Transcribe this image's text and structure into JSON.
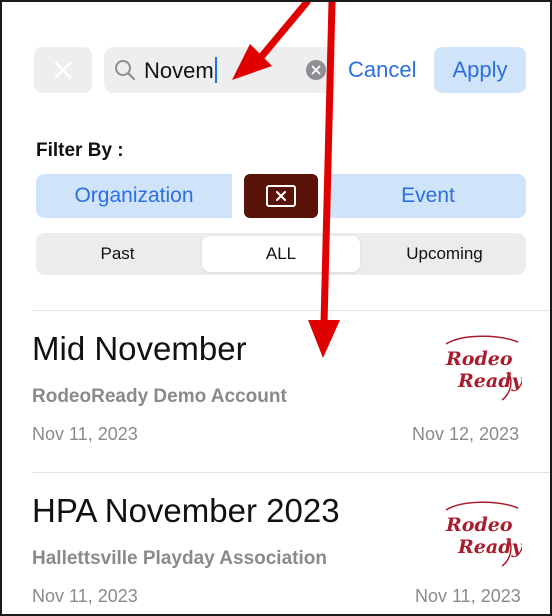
{
  "search": {
    "clear_icon": "close-icon",
    "search_icon": "search-icon",
    "query": "Novem",
    "clear_field_icon": "clear-circle-icon"
  },
  "actions": {
    "cancel_label": "Cancel",
    "apply_label": "Apply"
  },
  "filter": {
    "label": "Filter By :",
    "segments": [
      "Organization",
      "Event"
    ],
    "toggle_icon": "close-box-icon",
    "time_options": [
      "Past",
      "ALL",
      "Upcoming"
    ],
    "time_selected": "ALL"
  },
  "events": [
    {
      "title": "Mid November",
      "organization": "RodeoReady Demo Account",
      "start_date": "Nov 11, 2023",
      "end_date": "Nov 12, 2023",
      "logo_text": [
        "Rodeo",
        "Ready"
      ]
    },
    {
      "title": "HPA November 2023",
      "organization": "Hallettsville Playday Association",
      "start_date": "Nov 11, 2023",
      "end_date": "Nov 11, 2023",
      "logo_text": [
        "Rodeo",
        "Ready"
      ]
    }
  ],
  "colors": {
    "accent": "#2c6fe0",
    "segment_bg": "#cfe3f9",
    "toggle_bg": "#5a1307",
    "logo": "#a81c2c",
    "annotation_arrow": "#e00000"
  }
}
